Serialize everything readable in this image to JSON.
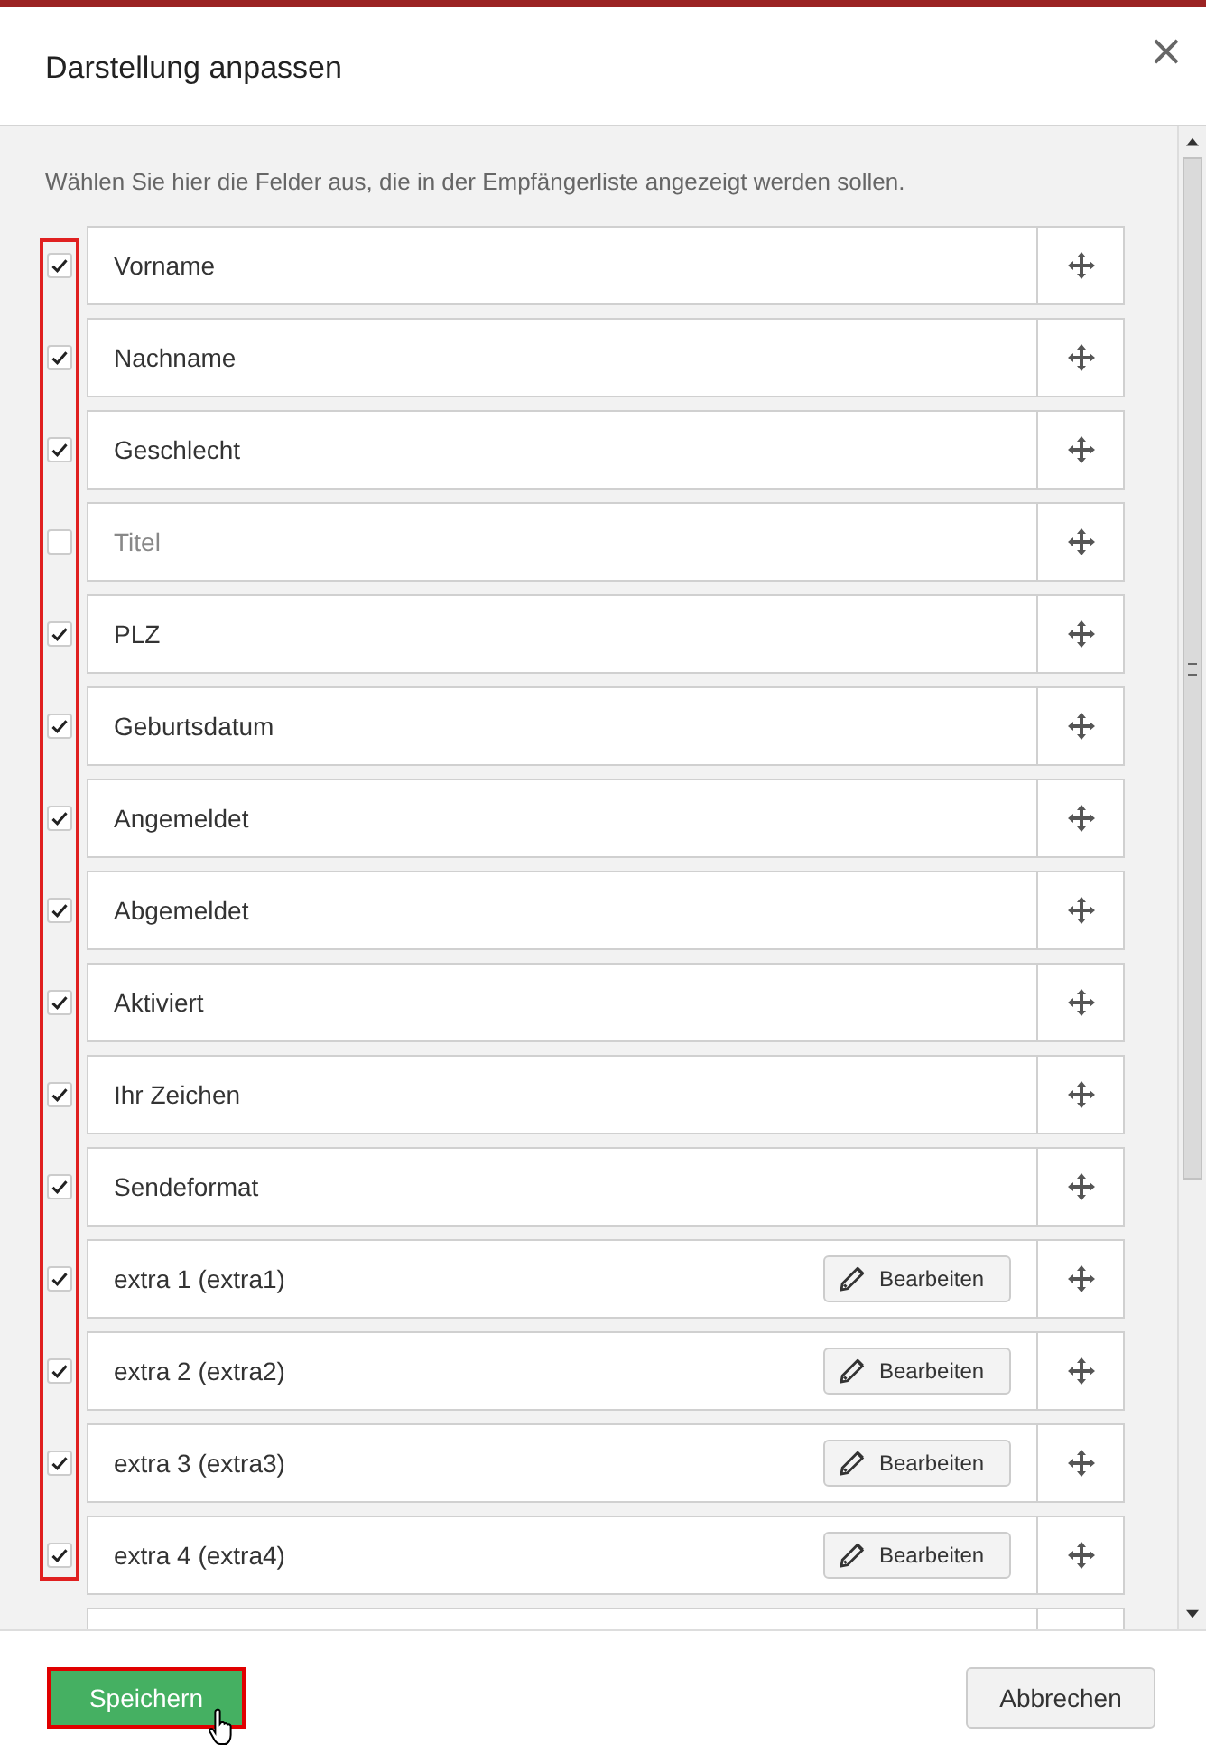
{
  "dialog": {
    "title": "Darstellung anpassen",
    "close": "×"
  },
  "intro": "Wählen Sie hier die Felder aus, die in der Empfängerliste angezeigt werden sollen.",
  "fields_highlighted": true,
  "fields": [
    {
      "kind": "plain",
      "label": "Vorname",
      "checked": true
    },
    {
      "kind": "plain",
      "label": "Nachname",
      "checked": true
    },
    {
      "kind": "plain",
      "label": "Geschlecht",
      "checked": true
    },
    {
      "kind": "plain",
      "label": "Titel",
      "checked": false
    },
    {
      "kind": "plain",
      "label": "PLZ",
      "checked": true
    },
    {
      "kind": "plain",
      "label": "Geburtsdatum",
      "checked": true
    },
    {
      "kind": "plain",
      "label": "Angemeldet",
      "checked": true
    },
    {
      "kind": "plain",
      "label": "Abgemeldet",
      "checked": true
    },
    {
      "kind": "plain",
      "label": "Aktiviert",
      "checked": true
    },
    {
      "kind": "plain",
      "label": "Ihr Zeichen",
      "checked": true
    },
    {
      "kind": "plain",
      "label": "Sendeformat",
      "checked": true
    },
    {
      "kind": "editable",
      "label": "extra 1 (extra1)",
      "checked": true,
      "edit": "Bearbeiten"
    },
    {
      "kind": "editable",
      "label": "extra 2 (extra2)",
      "checked": true,
      "edit": "Bearbeiten"
    },
    {
      "kind": "editable",
      "label": "extra 3 (extra3)",
      "checked": true,
      "edit": "Bearbeiten"
    },
    {
      "kind": "editable",
      "label": "extra 4 (extra4)",
      "checked": true,
      "edit": "Bearbeiten"
    },
    {
      "kind": "partial"
    }
  ],
  "buttons": [
    {
      "kind": "primary",
      "label": "Speichern",
      "highlighted": true,
      "hovered": true
    },
    {
      "kind": "secondary",
      "label": "Abbrechen",
      "highlighted": false,
      "hovered": false
    }
  ]
}
